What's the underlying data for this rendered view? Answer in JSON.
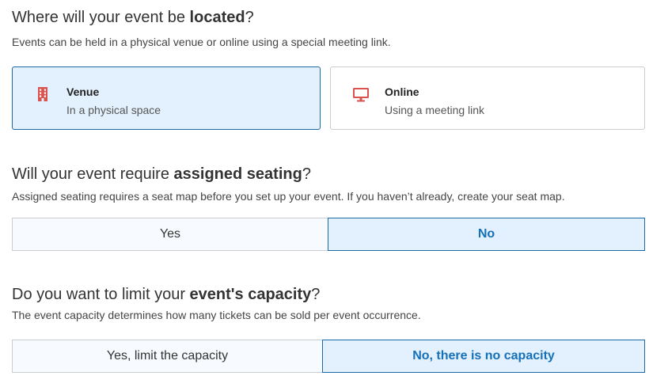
{
  "location": {
    "title_pre": "Where will your event be ",
    "title_bold": "located",
    "title_post": "?",
    "description": "Events can be held in a physical venue or online using a special meeting link.",
    "options": [
      {
        "title": "Venue",
        "subtitle": "In a physical space",
        "icon": "building-icon",
        "selected": true
      },
      {
        "title": "Online",
        "subtitle": "Using a meeting link",
        "icon": "monitor-icon",
        "selected": false
      }
    ]
  },
  "seating": {
    "title_pre": "Will your event require ",
    "title_bold": "assigned seating",
    "title_post": "?",
    "description": "Assigned seating requires a seat map before you set up your event. If you haven’t already, create your seat map.",
    "yes_label": "Yes",
    "no_label": "No",
    "selected": "No"
  },
  "capacity": {
    "title_pre": "Do you want to limit your ",
    "title_bold": "event's capacity",
    "title_post": "?",
    "description": "The event capacity determines how many tickets can be sold per event occurrence.",
    "yes_label": "Yes, limit the capacity",
    "no_label": "No, there is no capacity",
    "selected": "No, there is no capacity"
  },
  "colors": {
    "accent": "#1670b8",
    "selected_bg": "#e2f1fd",
    "icon_red": "#d9534f"
  }
}
